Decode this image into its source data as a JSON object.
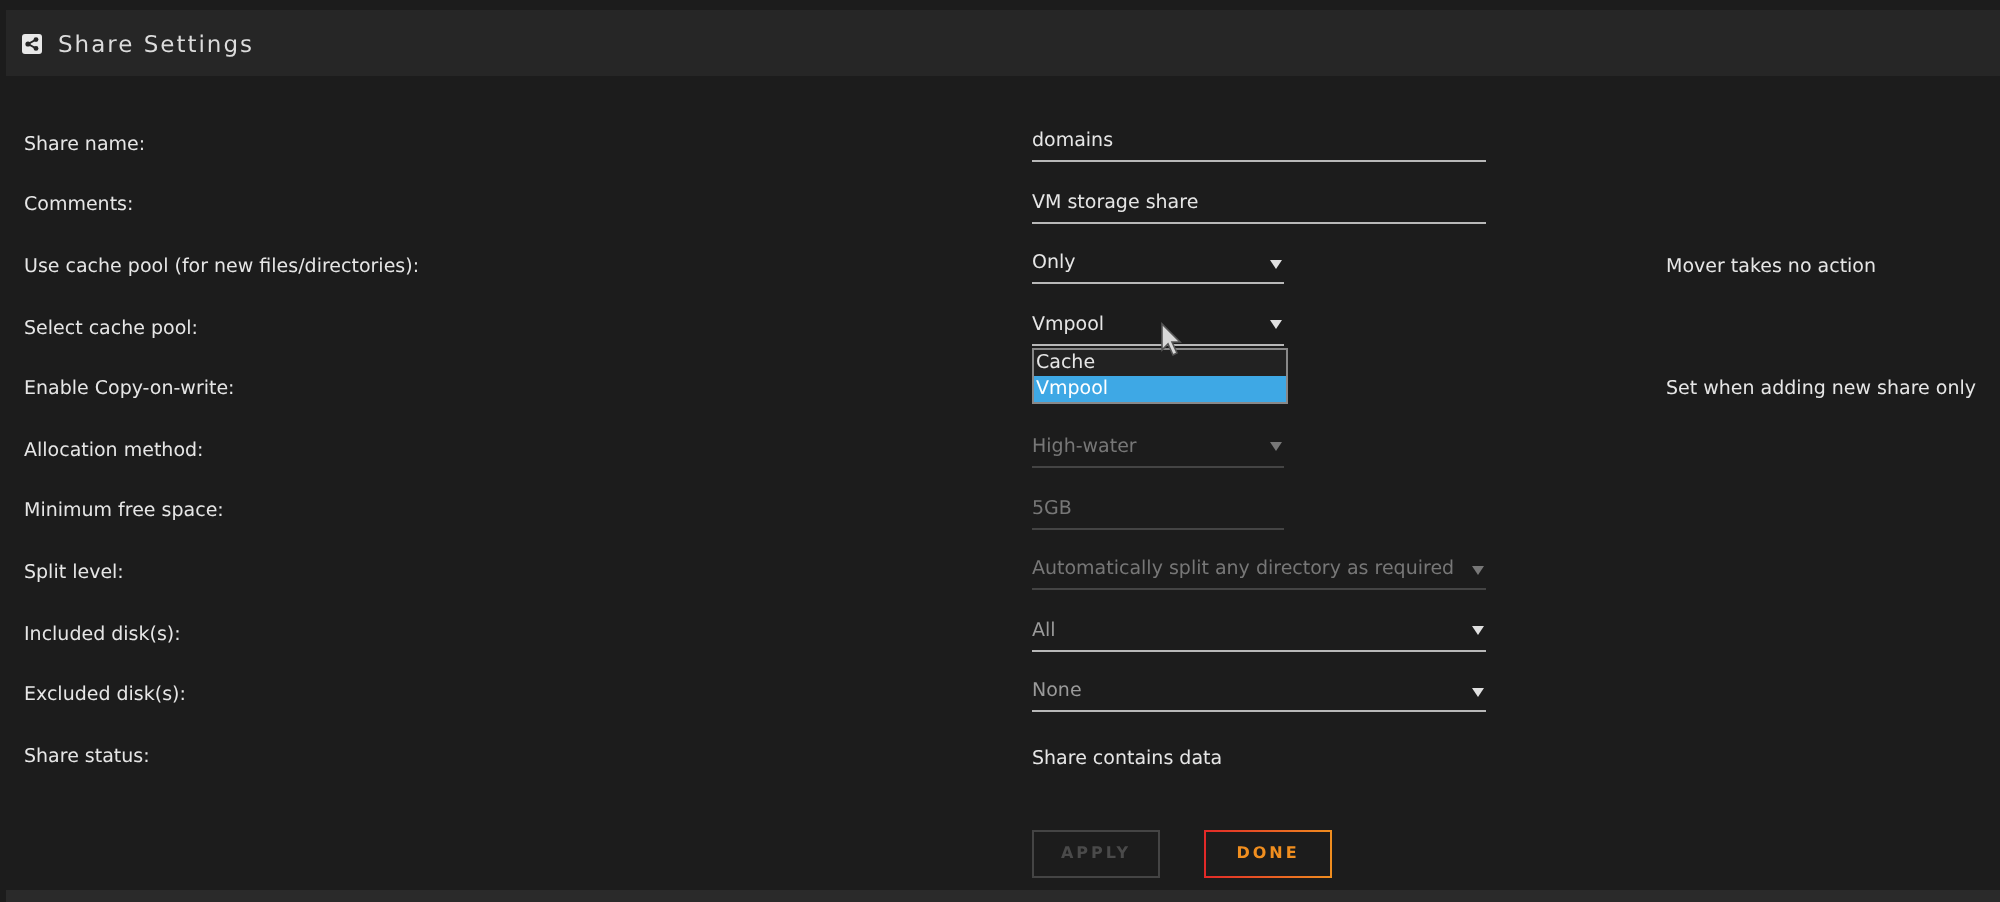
{
  "header": {
    "title": "Share Settings"
  },
  "rows": [
    {
      "label": "Share name:",
      "field": {
        "kind": "wide-text",
        "value": "domains",
        "disabled": false
      }
    },
    {
      "label": "Comments:",
      "field": {
        "kind": "wide-text",
        "value": "VM storage share",
        "disabled": false
      }
    },
    {
      "label": "Use cache pool (for new files/directories):",
      "field": {
        "kind": "select",
        "value": "Only",
        "disabled": false
      },
      "note": "Mover takes no action"
    },
    {
      "label": "Select cache pool:",
      "field": {
        "kind": "select",
        "value": "Vmpool",
        "disabled": false,
        "expanded": true,
        "options": [
          {
            "label": "Cache",
            "selected": false
          },
          {
            "label": "Vmpool",
            "selected": true
          }
        ]
      }
    },
    {
      "label": "Enable Copy-on-write:",
      "note": "Set when adding new share only"
    },
    {
      "label": "Allocation method:",
      "field": {
        "kind": "select",
        "value": "High-water",
        "disabled": true
      }
    },
    {
      "label": "Minimum free space:",
      "field": {
        "kind": "text",
        "value": "5GB",
        "disabled": true
      }
    },
    {
      "label": "Split level:",
      "field": {
        "kind": "wide-select",
        "value": "Automatically split any directory as required",
        "disabled": true
      }
    },
    {
      "label": "Included disk(s):",
      "field": {
        "kind": "wide-select",
        "value": "All",
        "disabled": false
      }
    },
    {
      "label": "Excluded disk(s):",
      "field": {
        "kind": "wide-select",
        "value": "None",
        "disabled": false
      }
    },
    {
      "label": "Share status:",
      "field": {
        "kind": "static",
        "value": "Share contains data"
      }
    }
  ],
  "buttons": [
    {
      "label": "APPLY",
      "disabled": true
    },
    {
      "label": "DONE",
      "disabled": false
    }
  ]
}
